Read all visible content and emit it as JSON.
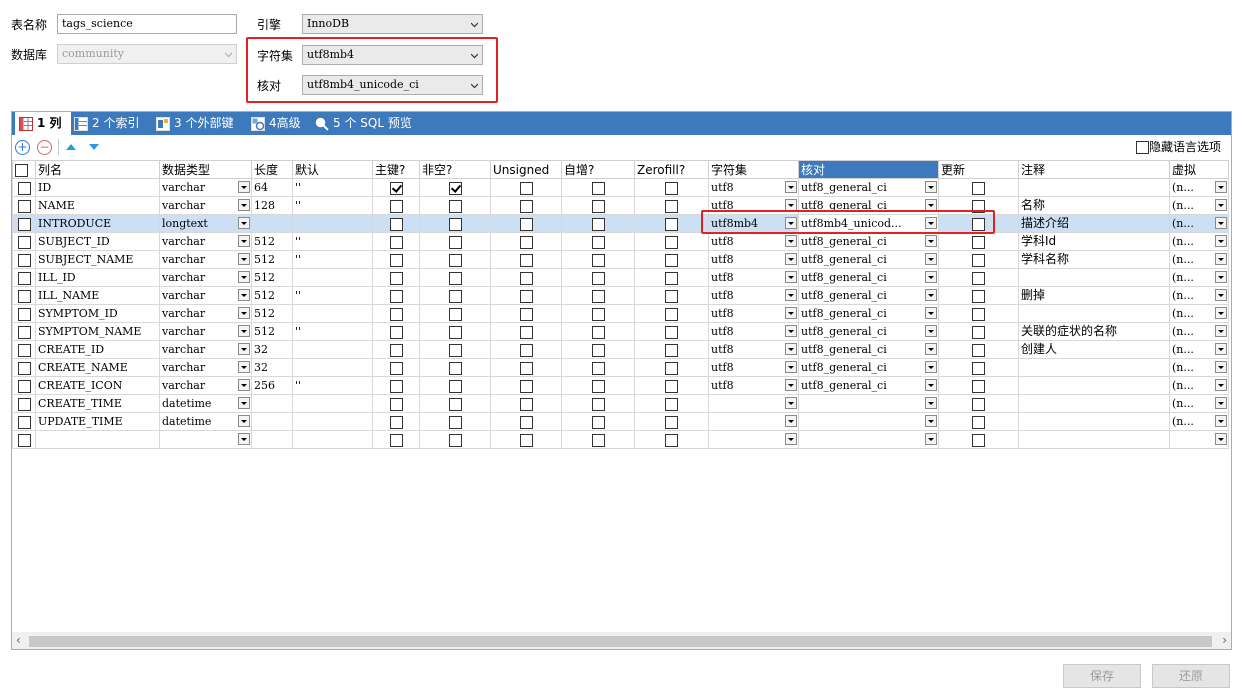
{
  "form": {
    "table_name_label": "表名称",
    "table_name_value": "tags_science",
    "database_label": "数据库",
    "database_value": "community",
    "engine_label": "引擎",
    "engine_value": "InnoDB",
    "charset_label": "字符集",
    "charset_value": "utf8mb4",
    "collation_label": "核对",
    "collation_value": "utf8mb4_unicode_ci"
  },
  "tabs": [
    {
      "label": "1 列",
      "icon": "columns-icon"
    },
    {
      "label": "2 个索引",
      "icon": "index-icon"
    },
    {
      "label": "3 个外部键",
      "icon": "foreign-key-icon"
    },
    {
      "label": "4高级",
      "icon": "advanced-icon"
    },
    {
      "label": "5 个 SQL 预览",
      "icon": "magnifier-icon"
    }
  ],
  "toolbar": {
    "hide_lang_label": "隐藏语言选项"
  },
  "grid": {
    "headers": [
      "列名",
      "数据类型",
      "长度",
      "默认",
      "主键?",
      "非空?",
      "Unsigned",
      "自增?",
      "Zerofill?",
      "字符集",
      "核对",
      "更新",
      "注释",
      "虚拟"
    ],
    "selected_header_index": 10,
    "selected_row_index": 2,
    "rows": [
      {
        "name": "ID",
        "type": "varchar",
        "length": "64",
        "default": "''",
        "pk": true,
        "notnull": true,
        "charset": "utf8",
        "collation": "utf8_general_ci",
        "comment": "",
        "virtual": "(n..."
      },
      {
        "name": "NAME",
        "type": "varchar",
        "length": "128",
        "default": "''",
        "pk": false,
        "notnull": false,
        "charset": "utf8",
        "collation": "utf8_general_ci",
        "comment": "名称",
        "virtual": "(n..."
      },
      {
        "name": "INTRODUCE",
        "type": "longtext",
        "length": "",
        "default": "",
        "pk": false,
        "notnull": false,
        "charset": "utf8mb4",
        "collation": "utf8mb4_unicod...",
        "comment": "描述介绍",
        "virtual": "(n..."
      },
      {
        "name": "SUBJECT_ID",
        "type": "varchar",
        "length": "512",
        "default": "''",
        "pk": false,
        "notnull": false,
        "charset": "utf8",
        "collation": "utf8_general_ci",
        "comment": "学科Id",
        "virtual": "(n..."
      },
      {
        "name": "SUBJECT_NAME",
        "type": "varchar",
        "length": "512",
        "default": "''",
        "pk": false,
        "notnull": false,
        "charset": "utf8",
        "collation": "utf8_general_ci",
        "comment": "学科名称",
        "virtual": "(n..."
      },
      {
        "name": "ILL_ID",
        "type": "varchar",
        "length": "512",
        "default": "",
        "pk": false,
        "notnull": false,
        "charset": "utf8",
        "collation": "utf8_general_ci",
        "comment": "",
        "virtual": "(n..."
      },
      {
        "name": "ILL_NAME",
        "type": "varchar",
        "length": "512",
        "default": "''",
        "pk": false,
        "notnull": false,
        "charset": "utf8",
        "collation": "utf8_general_ci",
        "comment": "删掉",
        "virtual": "(n..."
      },
      {
        "name": "SYMPTOM_ID",
        "type": "varchar",
        "length": "512",
        "default": "",
        "pk": false,
        "notnull": false,
        "charset": "utf8",
        "collation": "utf8_general_ci",
        "comment": "",
        "virtual": "(n..."
      },
      {
        "name": "SYMPTOM_NAME",
        "type": "varchar",
        "length": "512",
        "default": "''",
        "pk": false,
        "notnull": false,
        "charset": "utf8",
        "collation": "utf8_general_ci",
        "comment": "关联的症状的名称",
        "virtual": "(n..."
      },
      {
        "name": "CREATE_ID",
        "type": "varchar",
        "length": "32",
        "default": "",
        "pk": false,
        "notnull": false,
        "charset": "utf8",
        "collation": "utf8_general_ci",
        "comment": "创建人",
        "virtual": "(n..."
      },
      {
        "name": "CREATE_NAME",
        "type": "varchar",
        "length": "32",
        "default": "",
        "pk": false,
        "notnull": false,
        "charset": "utf8",
        "collation": "utf8_general_ci",
        "comment": "",
        "virtual": "(n..."
      },
      {
        "name": "CREATE_ICON",
        "type": "varchar",
        "length": "256",
        "default": "''",
        "pk": false,
        "notnull": false,
        "charset": "utf8",
        "collation": "utf8_general_ci",
        "comment": "",
        "virtual": "(n..."
      },
      {
        "name": "CREATE_TIME",
        "type": "datetime",
        "length": "",
        "default": "",
        "pk": false,
        "notnull": false,
        "charset": "",
        "collation": "",
        "comment": "",
        "virtual": "(n..."
      },
      {
        "name": "UPDATE_TIME",
        "type": "datetime",
        "length": "",
        "default": "",
        "pk": false,
        "notnull": false,
        "charset": "",
        "collation": "",
        "comment": "",
        "virtual": "(n..."
      },
      {
        "name": "",
        "type": "",
        "length": "",
        "default": "",
        "pk": false,
        "notnull": false,
        "charset": "",
        "collation": "",
        "comment": "",
        "virtual": ""
      }
    ]
  },
  "buttons": {
    "save": "保存",
    "revert": "还原"
  },
  "colors": {
    "accent": "#3d79bd",
    "highlight": "#e02222",
    "selected_row": "#cce0f5"
  }
}
